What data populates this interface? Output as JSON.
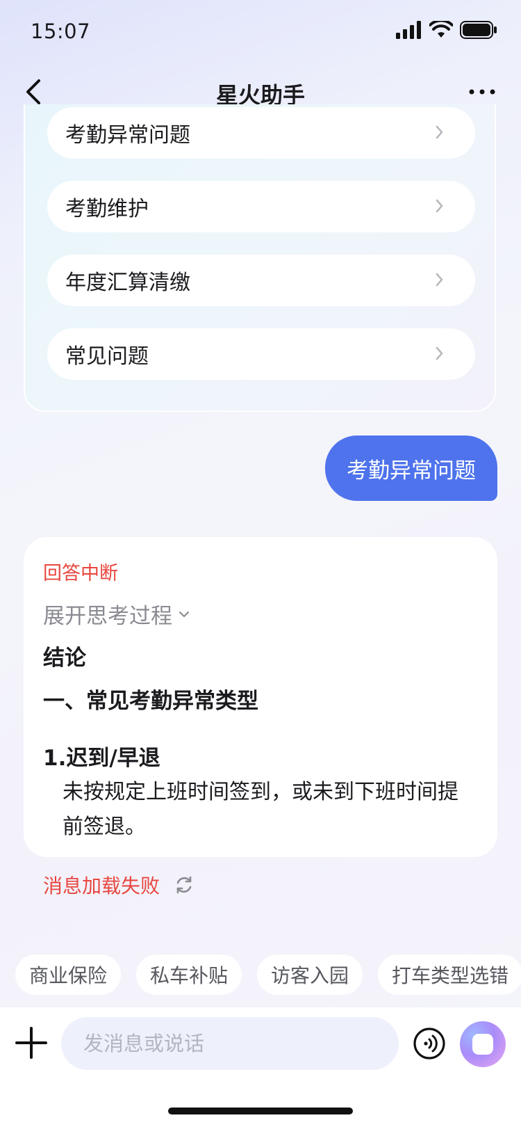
{
  "status_bar": {
    "time": "15:07"
  },
  "nav": {
    "title": "星火助手"
  },
  "menu": {
    "items": [
      {
        "label": "考勤异常问题"
      },
      {
        "label": "考勤维护"
      },
      {
        "label": "年度汇算清缴"
      },
      {
        "label": "常见问题"
      }
    ]
  },
  "user_message": "考勤异常问题",
  "answer": {
    "interrupt_label": "回答中断",
    "expand_label": "展开思考过程",
    "conclusion": "结论",
    "section_title": "一、常见考勤异常类型",
    "item_title": "1.迟到/早退",
    "item_body": "未按规定上班时间签到，或未到下班时间提前签退。"
  },
  "load_fail_text": "消息加载失败",
  "chips": [
    "商业保险",
    "私车补贴",
    "访客入园",
    "打车类型选错"
  ],
  "input": {
    "placeholder": "发消息或说话"
  },
  "colors": {
    "accent": "#4e73ec",
    "error": "#e8463f"
  }
}
